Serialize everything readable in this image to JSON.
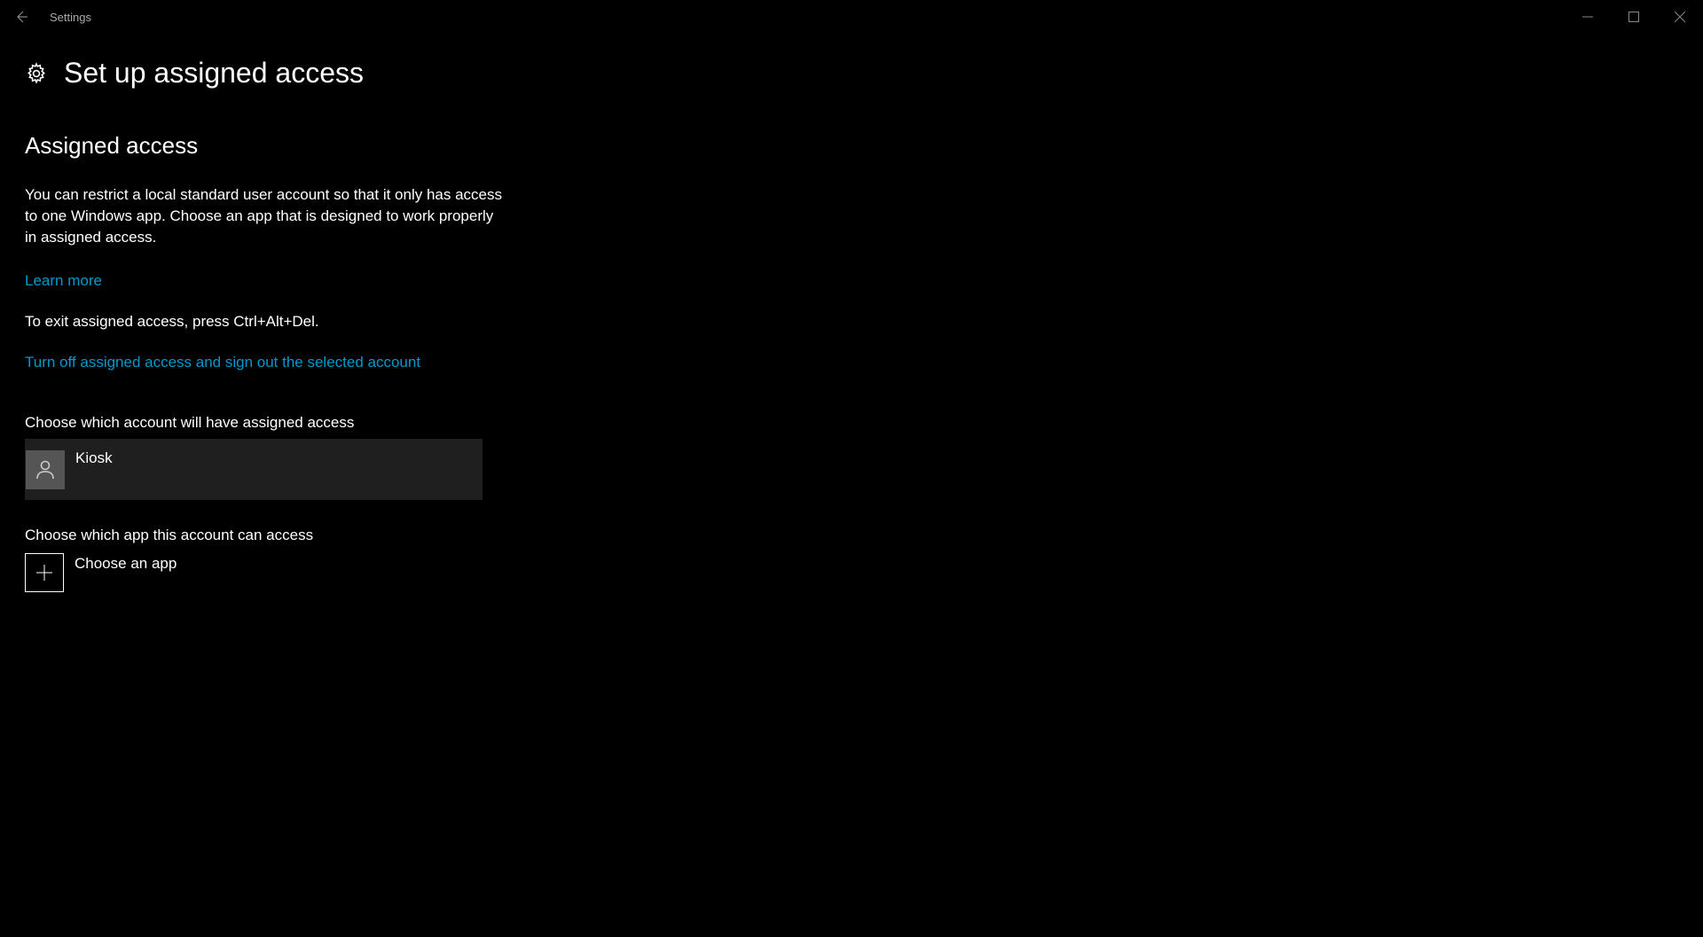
{
  "titlebar": {
    "title": "Settings"
  },
  "header": {
    "title": "Set up assigned access"
  },
  "main": {
    "heading": "Assigned access",
    "description": "You can restrict a local standard user account so that it only has access to one Windows app. Choose an app that is designed to work properly in assigned access.",
    "learn_more": "Learn more",
    "exit_instruction": "To exit assigned access, press Ctrl+Alt+Del.",
    "turn_off_link": "Turn off assigned access and sign out the selected account",
    "choose_account_label": "Choose which account will have assigned access",
    "account_name": "Kiosk",
    "choose_app_label": "Choose which app this account can access",
    "choose_app_button": "Choose an app"
  }
}
